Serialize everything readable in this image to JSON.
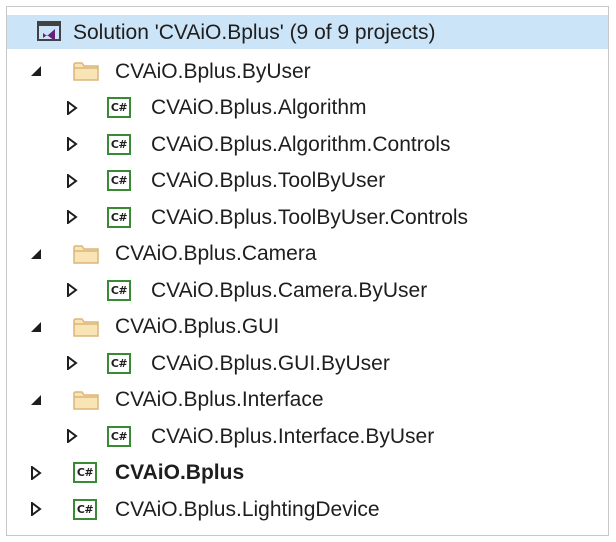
{
  "solution": {
    "label": "Solution 'CVAiO.Bplus' (9 of 9 projects)",
    "icon": "visual-studio-solution-icon"
  },
  "tree": [
    {
      "type": "folder",
      "label": "CVAiO.Bplus.ByUser",
      "expanded": true,
      "icon": "folder-icon",
      "children": [
        {
          "type": "project",
          "label": "CVAiO.Bplus.Algorithm",
          "icon": "csharp-project-icon",
          "icon_text": "C#"
        },
        {
          "type": "project",
          "label": "CVAiO.Bplus.Algorithm.Controls",
          "icon": "csharp-project-icon",
          "icon_text": "C#"
        },
        {
          "type": "project",
          "label": "CVAiO.Bplus.ToolByUser",
          "icon": "csharp-project-icon",
          "icon_text": "C#"
        },
        {
          "type": "project",
          "label": "CVAiO.Bplus.ToolByUser.Controls",
          "icon": "csharp-project-icon",
          "icon_text": "C#"
        }
      ]
    },
    {
      "type": "folder",
      "label": "CVAiO.Bplus.Camera",
      "expanded": true,
      "icon": "folder-icon",
      "children": [
        {
          "type": "project",
          "label": "CVAiO.Bplus.Camera.ByUser",
          "icon": "csharp-project-icon",
          "icon_text": "C#"
        }
      ]
    },
    {
      "type": "folder",
      "label": "CVAiO.Bplus.GUI",
      "expanded": true,
      "icon": "folder-icon",
      "children": [
        {
          "type": "project",
          "label": "CVAiO.Bplus.GUI.ByUser",
          "icon": "csharp-project-icon",
          "icon_text": "C#"
        }
      ]
    },
    {
      "type": "folder",
      "label": "CVAiO.Bplus.Interface",
      "expanded": true,
      "icon": "folder-icon",
      "children": [
        {
          "type": "project",
          "label": "CVAiO.Bplus.Interface.ByUser",
          "icon": "csharp-project-icon",
          "icon_text": "C#"
        }
      ]
    },
    {
      "type": "project",
      "label": "CVAiO.Bplus",
      "bold": true,
      "icon": "csharp-project-icon",
      "icon_text": "C#"
    },
    {
      "type": "project",
      "label": "CVAiO.Bplus.LightingDevice",
      "icon": "csharp-project-icon",
      "icon_text": "C#"
    }
  ],
  "colors": {
    "selection": "#cce4f7",
    "folder": "#dcb67a",
    "csharp_border": "#388a34",
    "vs_purple": "#68217a"
  }
}
